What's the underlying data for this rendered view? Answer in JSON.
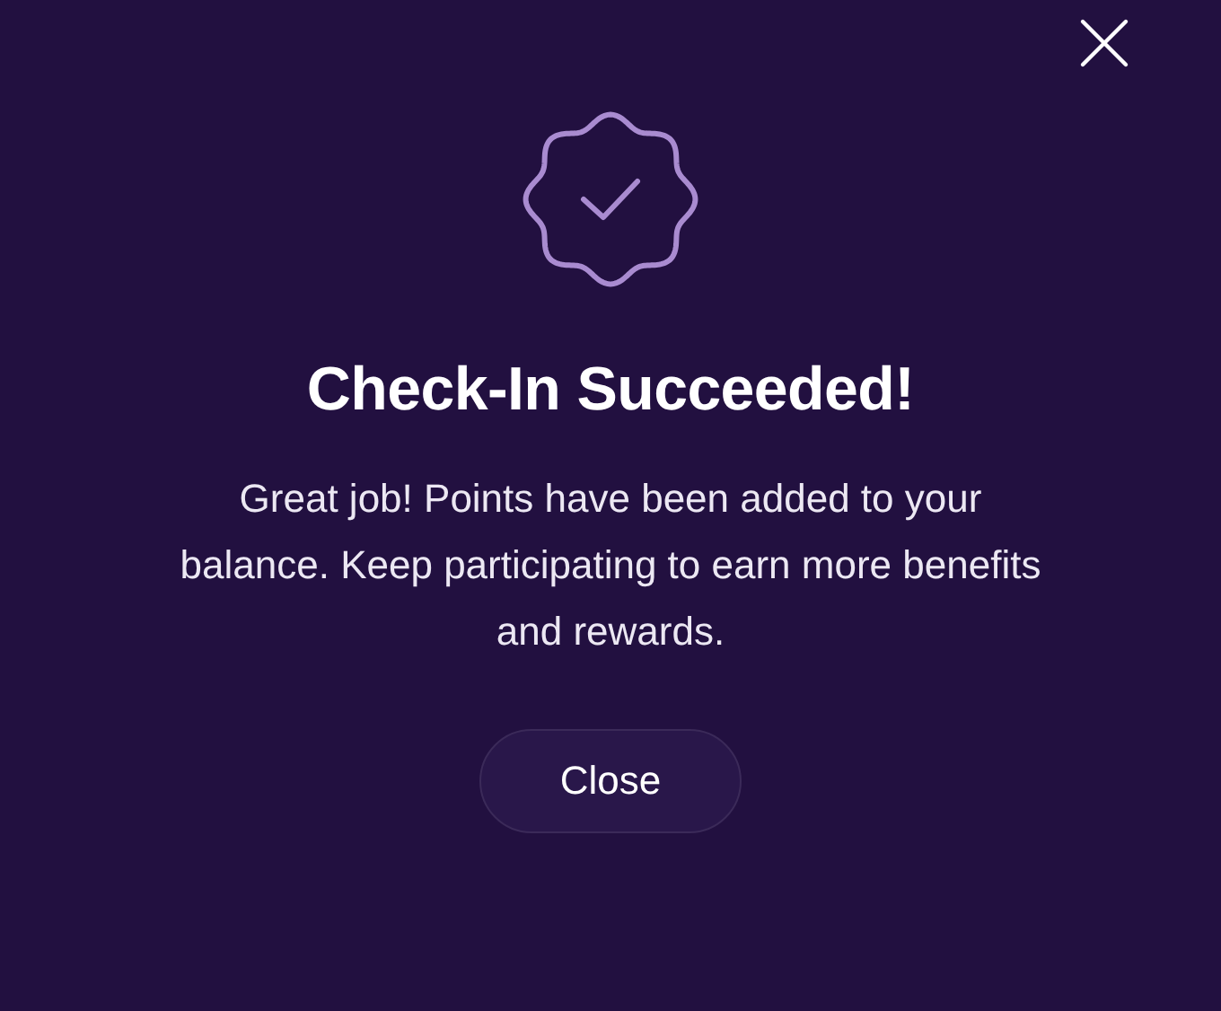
{
  "title": "Check-In Succeeded!",
  "message": "Great job! Points have been added to your balance. Keep participating to earn more benefits and rewards.",
  "buttons": [
    {
      "label": "Close"
    }
  ]
}
